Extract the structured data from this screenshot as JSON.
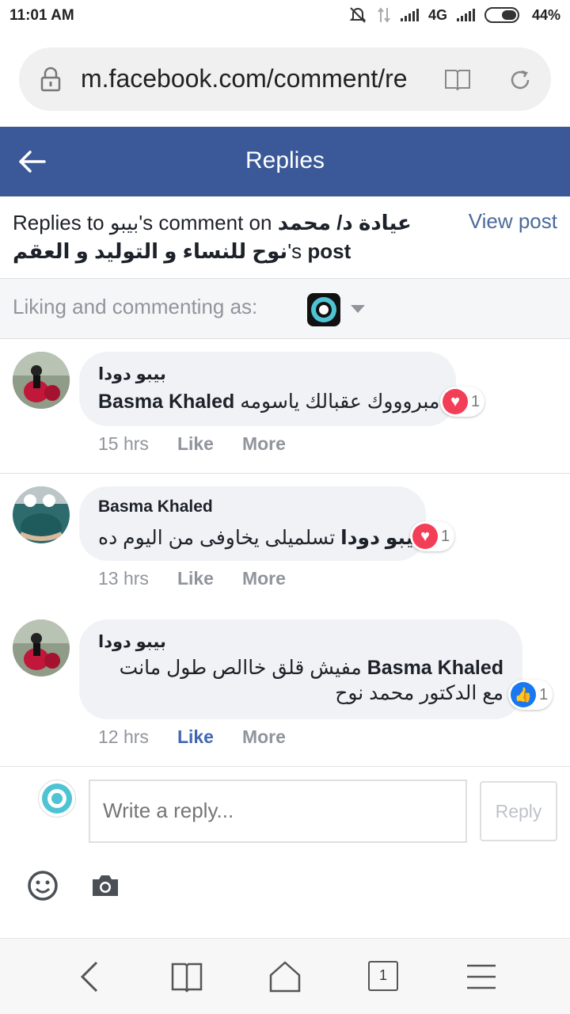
{
  "status": {
    "time": "11:01 AM",
    "network": "4G",
    "battery": "44%"
  },
  "browser": {
    "url": "m.facebook.com/comment/re",
    "tab_count": "1"
  },
  "header": {
    "title": "Replies"
  },
  "replies_to": {
    "prefix": "Replies to ",
    "commenter": "بيبو",
    "mid": "'s comment on ",
    "page_part1": "عيادة د/ محمد",
    "page_part2": "نوح للنساء و التوليد و العقم",
    "suffix": "'s ",
    "post_word": "post",
    "view_post": "View post"
  },
  "liking": {
    "label": "Liking and commenting as:"
  },
  "comments": [
    {
      "author": "بيبو دودا",
      "mention": "Basma Khaled",
      "text": "مبروووك عقبالك ياسومه",
      "reaction": "heart",
      "reaction_count": "1",
      "time": "15 hrs",
      "like": "Like",
      "more": "More"
    },
    {
      "author": "Basma Khaled",
      "mention": "بيبو دودا",
      "text": "تسلميلى يخاوفى من اليوم ده",
      "reaction": "heart",
      "reaction_count": "1",
      "time": "13 hrs",
      "like": "Like",
      "more": "More"
    },
    {
      "author": "بيبو دودا",
      "mention": "Basma Khaled",
      "text_line1": "مفيش قلق خاالص طول مانت",
      "text_line2": "مع الدكتور محمد نوح",
      "reaction": "like",
      "reaction_count": "1",
      "time": "12 hrs",
      "like": "Like",
      "more": "More"
    }
  ],
  "reply": {
    "placeholder": "Write a reply...",
    "button": "Reply"
  },
  "colors": {
    "fb_blue": "#3b5998",
    "heart": "#f33e58",
    "like_blue": "#1877f2",
    "link": "#4267b2"
  }
}
